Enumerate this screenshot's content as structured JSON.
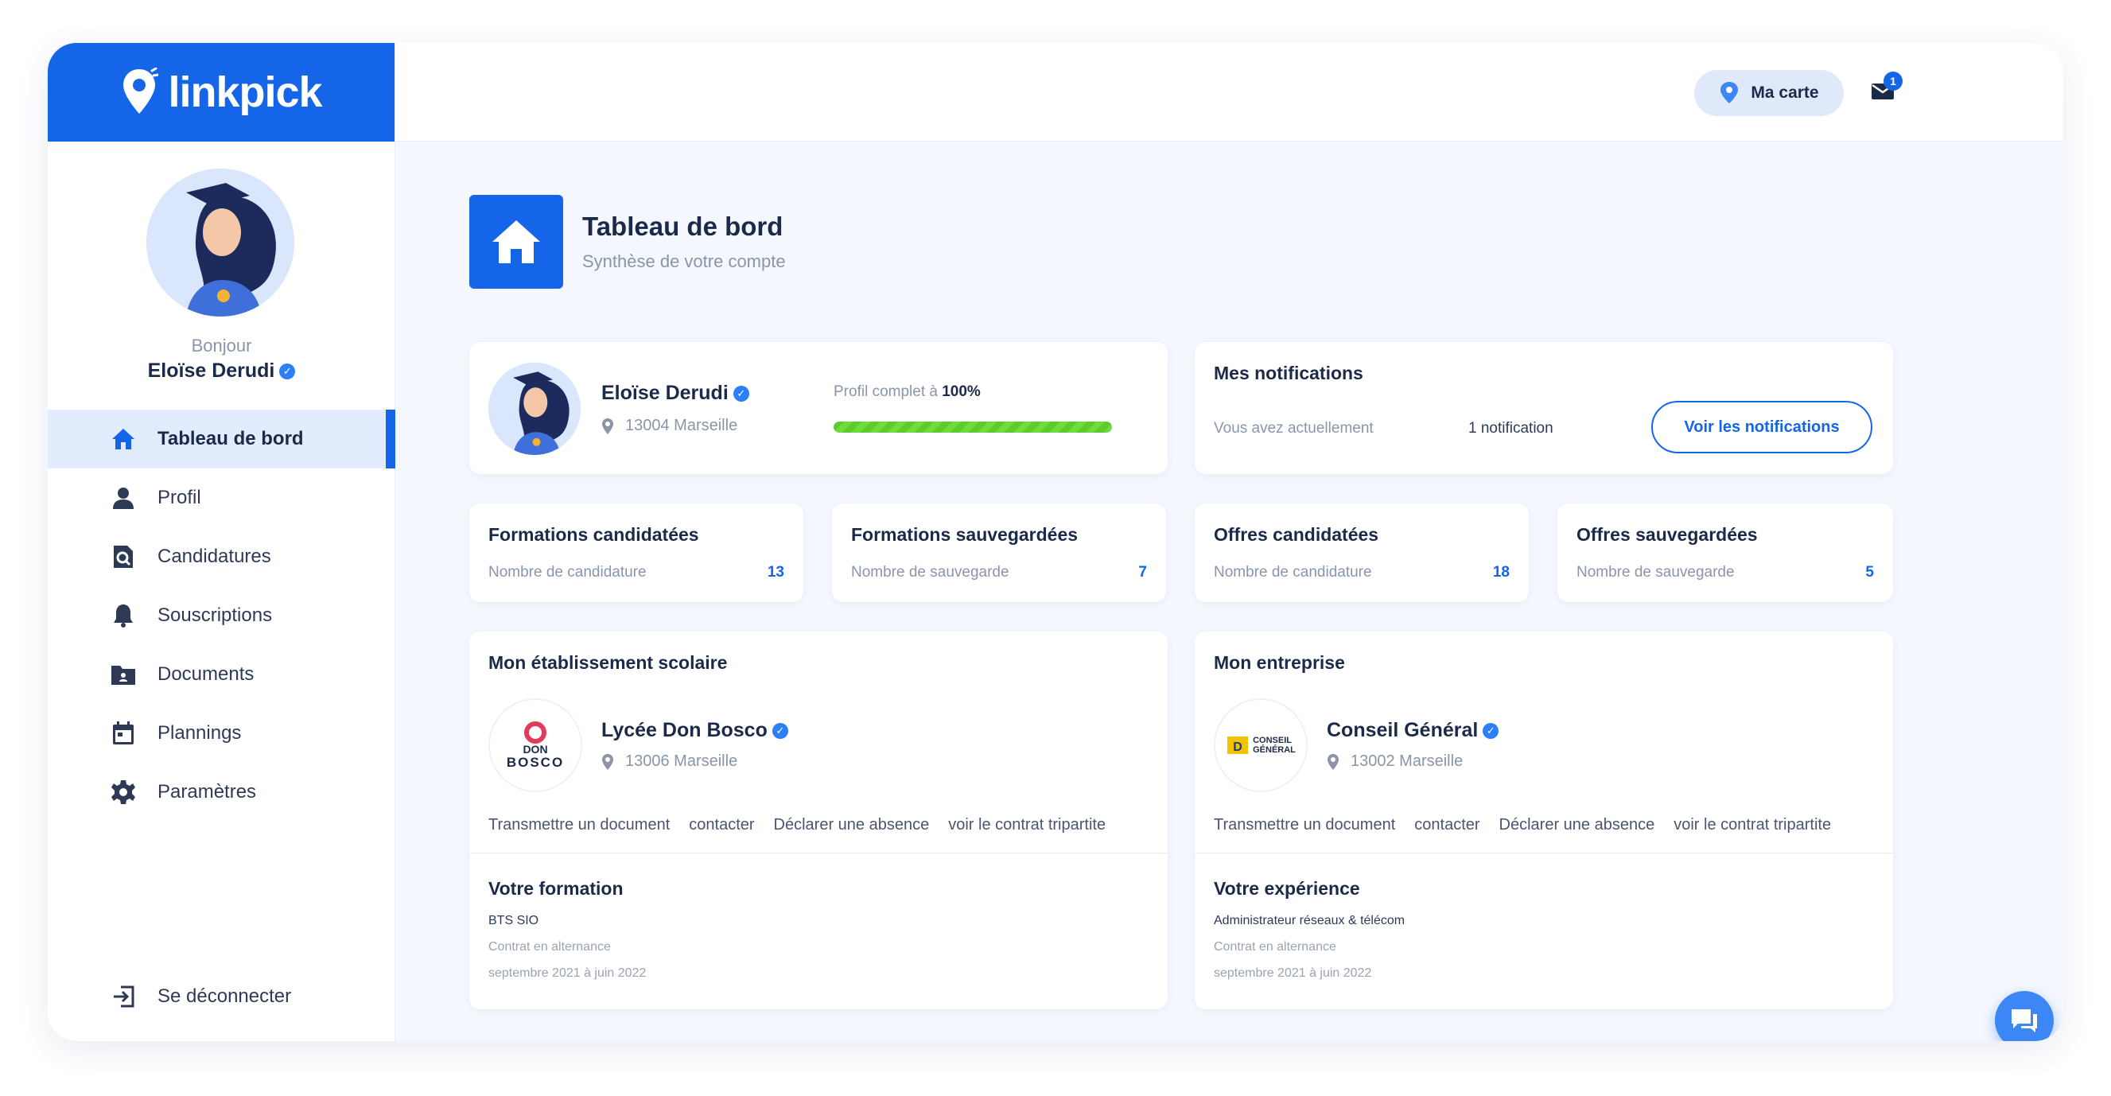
{
  "brand": {
    "name": "linkpick",
    "color": "#1565e8"
  },
  "sidebar": {
    "greeting": "Bonjour",
    "user_name": "Eloïse Derudi",
    "items": [
      {
        "label": "Tableau de bord",
        "icon": "home-icon",
        "active": true
      },
      {
        "label": "Profil",
        "icon": "user-icon"
      },
      {
        "label": "Candidatures",
        "icon": "search-document-icon"
      },
      {
        "label": "Souscriptions",
        "icon": "bell-icon"
      },
      {
        "label": "Documents",
        "icon": "folder-icon"
      },
      {
        "label": "Plannings",
        "icon": "calendar-icon"
      },
      {
        "label": "Paramètres",
        "icon": "gear-icon"
      }
    ],
    "logout_label": "Se déconnecter"
  },
  "topbar": {
    "map_label": "Ma carte",
    "mail_count": "1"
  },
  "header": {
    "title": "Tableau de bord",
    "subtitle": "Synthèse de votre compte"
  },
  "profile_card": {
    "name": "Eloïse Derudi",
    "location": "13004 Marseille",
    "completion_prefix": "Profil complet à",
    "completion_value": "100%",
    "completion_fraction": 1.0
  },
  "notifications": {
    "title": "Mes notifications",
    "text": "Vous avez actuellement",
    "count_text": "1 notification",
    "button": "Voir les notifications"
  },
  "stats": [
    {
      "title": "Formations candidatées",
      "label": "Nombre de candidature",
      "value": "13"
    },
    {
      "title": "Formations sauvegardées",
      "label": "Nombre de sauvegarde",
      "value": "7"
    },
    {
      "title": "Offres candidatées",
      "label": "Nombre de candidature",
      "value": "18"
    },
    {
      "title": "Offres sauvegardées",
      "label": "Nombre de sauvegarde",
      "value": "5"
    }
  ],
  "school": {
    "title": "Mon établissement scolaire",
    "name": "Lycée Don Bosco",
    "location": "13006 Marseille",
    "logo_text_1": "DON",
    "logo_text_2": "BOSCO",
    "links": [
      "Transmettre un document",
      "contacter",
      "Déclarer une absence",
      "voir le contrat tripartite"
    ],
    "sub_title": "Votre formation",
    "line1": "BTS SIO",
    "line2": "Contrat en alternance",
    "line3": "septembre 2021 à juin 2022"
  },
  "company": {
    "title": "Mon entreprise",
    "name": "Conseil Général",
    "location": "13002 Marseille",
    "logo_text_1": "CONSEIL",
    "logo_text_2": "GÉNÉRAL",
    "links": [
      "Transmettre un document",
      "contacter",
      "Déclarer une absence",
      "voir le contrat tripartite"
    ],
    "sub_title": "Votre expérience",
    "line1": "Administrateur réseaux & télécom",
    "line2": "Contrat en alternance",
    "line3": "septembre 2021 à juin 2022"
  }
}
